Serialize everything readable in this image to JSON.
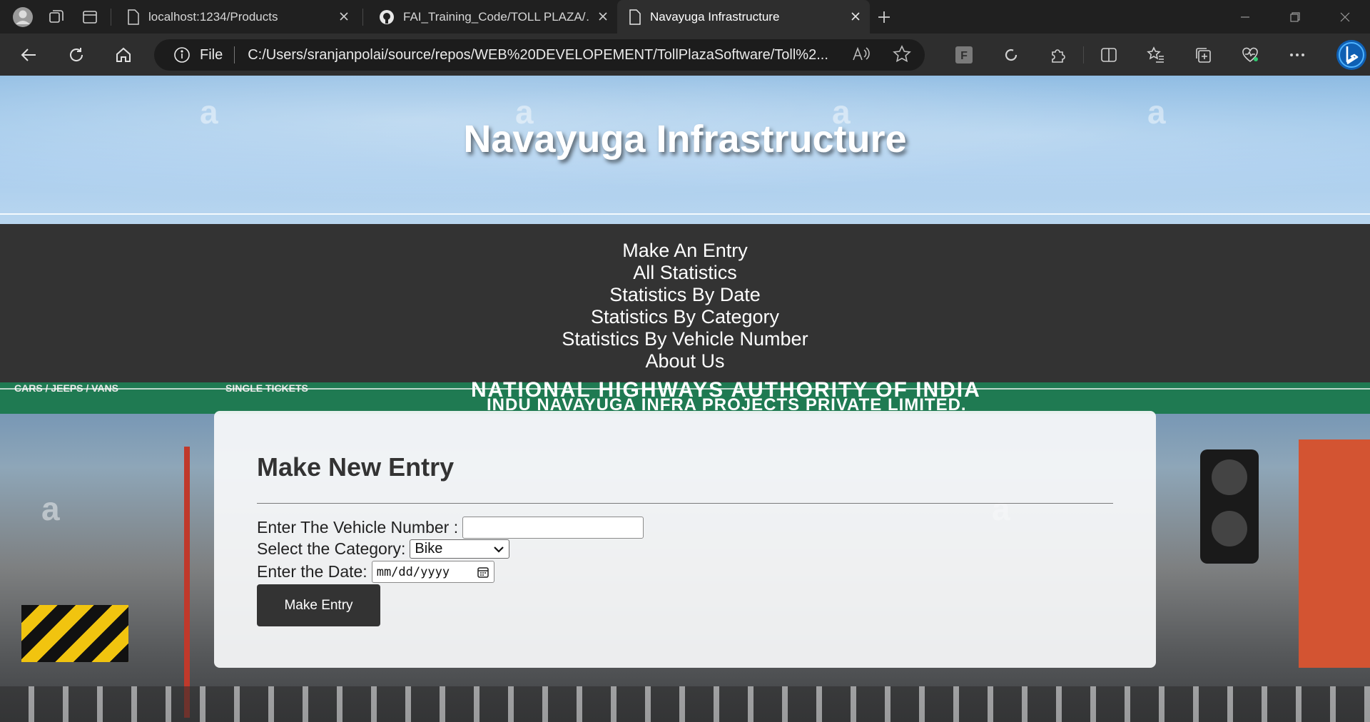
{
  "browser": {
    "tabs": [
      {
        "title": "localhost:1234/Products",
        "active": false
      },
      {
        "title": "FAI_Training_Code/TOLL PLAZA/…",
        "active": false
      },
      {
        "title": "Navayuga Infrastructure",
        "active": true
      }
    ],
    "address": {
      "scheme_label": "File",
      "url": "C:/Users/sranjanpolai/source/repos/WEB%20DEVELOPEMENT/TollPlazaSoftware/Toll%2..."
    },
    "extension_badge": "F"
  },
  "site": {
    "title": "Navayuga Infrastructure",
    "watermark_glyph": "a"
  },
  "menu": {
    "items": [
      "Make An Entry",
      "All Statistics",
      "Statistics By Date",
      "Statistics By Category",
      "Statistics By Vehicle Number",
      "About Us"
    ]
  },
  "background_photo": {
    "sign_line_1": "NATIONAL HIGHWAYS AUTHORITY OF INDIA",
    "sign_line_2": "INDU NAVAYUGA INFRA PROJECTS PRIVATE LIMITED.",
    "sign_left_1": "CARS / JEEPS / VANS",
    "sign_left_2": "SINGLE TICKETS"
  },
  "form": {
    "heading": "Make New Entry",
    "vehicle_label": "Enter The Vehicle Number :",
    "vehicle_value": "",
    "category_label": "Select the Category:",
    "category_selected": "Bike",
    "date_label": "Enter the Date:",
    "date_placeholder": "mm/dd/yyyy",
    "submit_label": "Make Entry"
  },
  "colors": {
    "menu_bg": "#333333",
    "button_bg": "#333333",
    "browser_bg": "#202020"
  }
}
